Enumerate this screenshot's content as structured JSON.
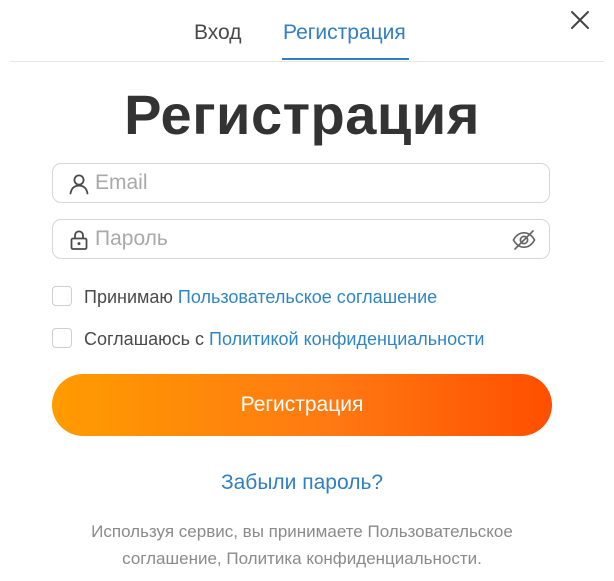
{
  "tabs": {
    "login_label": "Вход",
    "register_label": "Регистрация",
    "active": "register"
  },
  "title": "Регистрация",
  "email": {
    "placeholder": "Email",
    "value": ""
  },
  "password": {
    "placeholder": "Пароль",
    "value": ""
  },
  "checkboxes": {
    "terms_prefix": "Принимаю ",
    "terms_link": "Пользовательское соглашение",
    "privacy_prefix": "Соглашаюсь с ",
    "privacy_link": "Политикой конфиденциальности"
  },
  "submit_label": "Регистрация",
  "forgot_label": "Забыли пароль?",
  "footer": {
    "line1": "Используя сервис, вы принимаете Пользовательское",
    "line2": "соглашение, Политика конфиденциальности."
  },
  "icons": {
    "close": "close-icon",
    "email": "user-icon",
    "password": "lock-icon",
    "toggle_visibility": "eye-off-icon"
  },
  "colors": {
    "accent": "#2f7fc1",
    "link": "#2f86c6",
    "button_gradient_start": "#ff9b00",
    "button_gradient_end": "#ff4f00",
    "title": "#333333",
    "muted": "#8a8a8a"
  }
}
